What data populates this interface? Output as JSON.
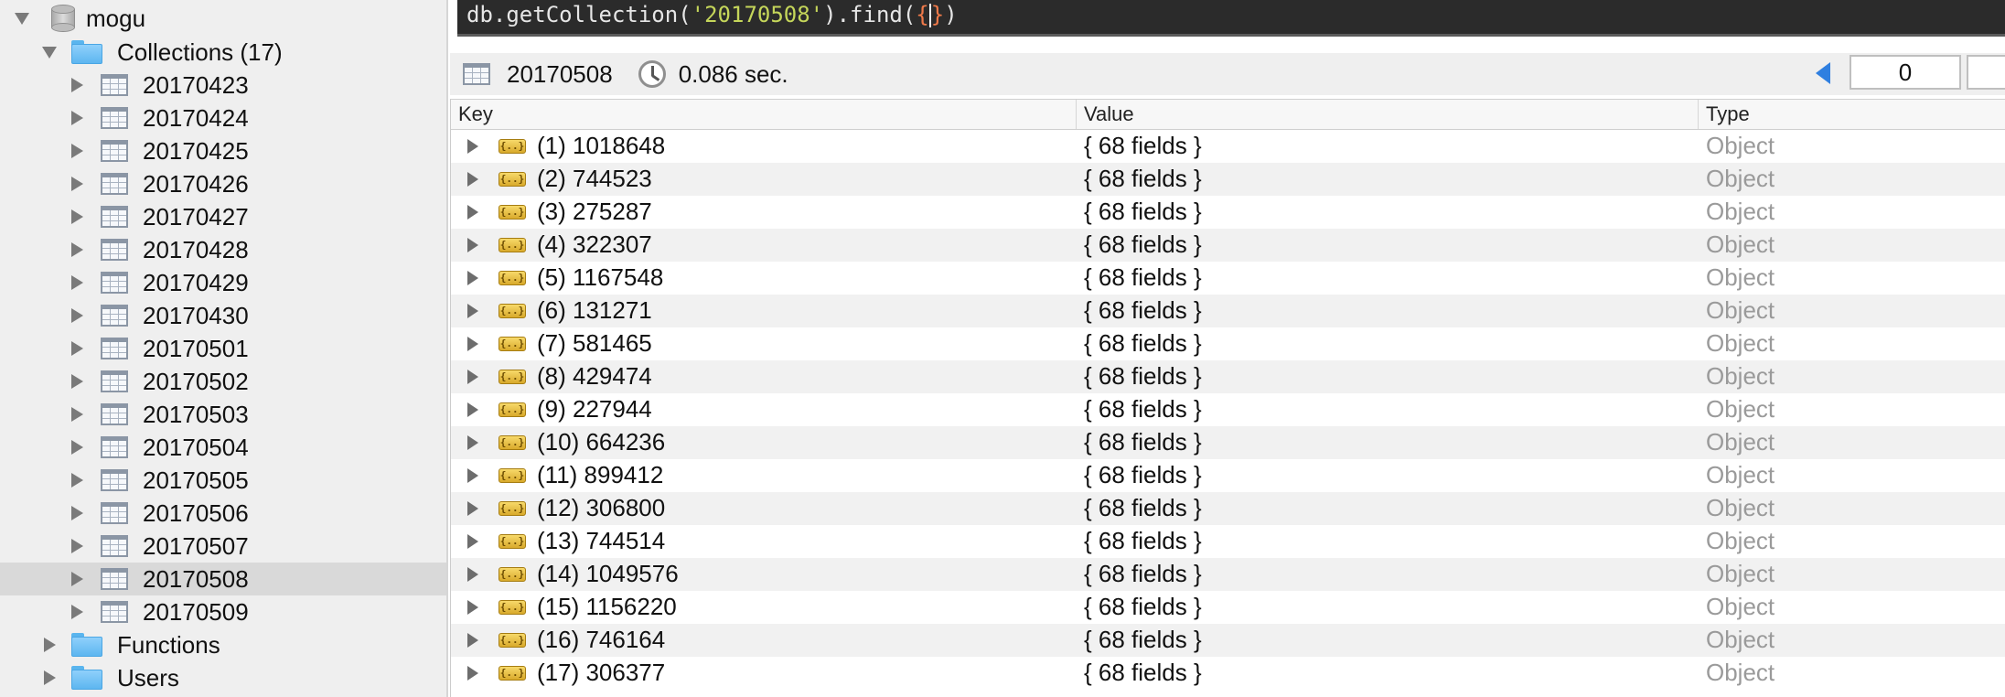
{
  "sidebar": {
    "database": "mogu",
    "collections_label": "Collections (17)",
    "collections": [
      "20170423",
      "20170424",
      "20170425",
      "20170426",
      "20170427",
      "20170428",
      "20170429",
      "20170430",
      "20170501",
      "20170502",
      "20170503",
      "20170504",
      "20170505",
      "20170506",
      "20170507",
      "20170508",
      "20170509"
    ],
    "selected_collection": "20170508",
    "functions_label": "Functions",
    "users_label": "Users",
    "icons": {
      "database": "database-icon",
      "folder": "folder-icon",
      "collection": "table-icon",
      "expand": "disclosure-triangle-icon"
    }
  },
  "query": {
    "prefix": "db.getCollection(",
    "collection_string": "'20170508'",
    "middle": ").find(",
    "open_brace": "{",
    "close_brace": "}",
    "suffix": ")"
  },
  "info": {
    "collection": "20170508",
    "time": "0.086 sec.",
    "page_value": "0"
  },
  "table": {
    "headers": {
      "key": "Key",
      "value": "Value",
      "type": "Type"
    },
    "rows": [
      {
        "key": "(1) 1018648",
        "value": "{ 68 fields }",
        "type": "Object"
      },
      {
        "key": "(2) 744523",
        "value": "{ 68 fields }",
        "type": "Object"
      },
      {
        "key": "(3) 275287",
        "value": "{ 68 fields }",
        "type": "Object"
      },
      {
        "key": "(4) 322307",
        "value": "{ 68 fields }",
        "type": "Object"
      },
      {
        "key": "(5) 1167548",
        "value": "{ 68 fields }",
        "type": "Object"
      },
      {
        "key": "(6) 131271",
        "value": "{ 68 fields }",
        "type": "Object"
      },
      {
        "key": "(7) 581465",
        "value": "{ 68 fields }",
        "type": "Object"
      },
      {
        "key": "(8) 429474",
        "value": "{ 68 fields }",
        "type": "Object"
      },
      {
        "key": "(9) 227944",
        "value": "{ 68 fields }",
        "type": "Object"
      },
      {
        "key": "(10) 664236",
        "value": "{ 68 fields }",
        "type": "Object"
      },
      {
        "key": "(11) 899412",
        "value": "{ 68 fields }",
        "type": "Object"
      },
      {
        "key": "(12) 306800",
        "value": "{ 68 fields }",
        "type": "Object"
      },
      {
        "key": "(13) 744514",
        "value": "{ 68 fields }",
        "type": "Object"
      },
      {
        "key": "(14) 1049576",
        "value": "{ 68 fields }",
        "type": "Object"
      },
      {
        "key": "(15) 1156220",
        "value": "{ 68 fields }",
        "type": "Object"
      },
      {
        "key": "(16) 746164",
        "value": "{ 68 fields }",
        "type": "Object"
      },
      {
        "key": "(17) 306377",
        "value": "{ 68 fields }",
        "type": "Object"
      }
    ],
    "row_icon": "object-icon",
    "row_icon_glyph": "{..}"
  },
  "colors": {
    "query_bg": "#2b2b2b",
    "string": "#c5d65a",
    "brace": "#f07a4a",
    "selection": "#d9d9d9",
    "type_text": "#9a9a9a",
    "accent": "#2f7fe0"
  }
}
